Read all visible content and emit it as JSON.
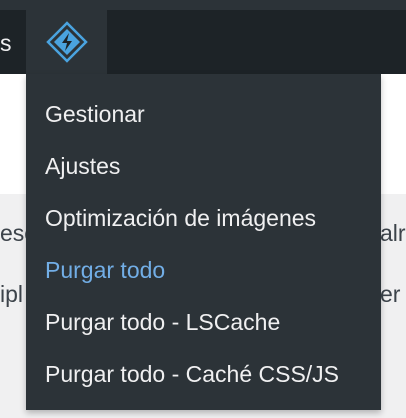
{
  "adminbar": {
    "label_fragment": "s",
    "plugin_icon": "litespeed-diamond-icon",
    "accent_color": "#4aa3df"
  },
  "background": {
    "fragment_left_1": "esc",
    "fragment_left_2": "ipl",
    "fragment_right_1": "alr",
    "fragment_right_2": "er"
  },
  "menu": {
    "items": [
      {
        "label": "Gestionar"
      },
      {
        "label": "Ajustes"
      },
      {
        "label": "Optimización de imágenes"
      },
      {
        "label": "Purgar todo",
        "state": "hovered",
        "color": "#72aee6"
      },
      {
        "label": "Purgar todo - LSCache"
      },
      {
        "label": "Purgar todo - Caché CSS/JS"
      }
    ]
  }
}
